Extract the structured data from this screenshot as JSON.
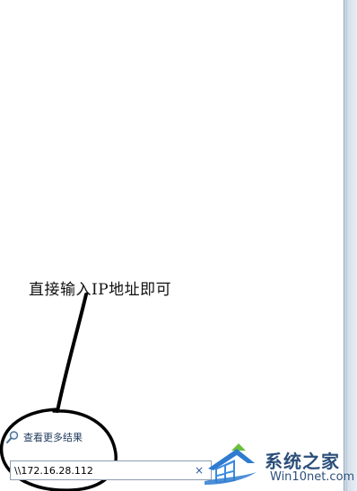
{
  "annotation": {
    "text": "直接输入IP地址即可"
  },
  "start_menu": {
    "more_results_label": "查看更多结果",
    "search_value": "\\\\172.16.28.112",
    "clear_glyph": "×"
  },
  "watermark": {
    "title": "系统之家",
    "subtitle": "Win10net.com"
  },
  "icons": {
    "more_results": "magnifier-icon",
    "clear": "close-icon",
    "logo": "house-logo-icon"
  },
  "colors": {
    "link": "#1e395b",
    "annotation_ink": "#000000",
    "watermark_text": "#2c4f7a"
  }
}
